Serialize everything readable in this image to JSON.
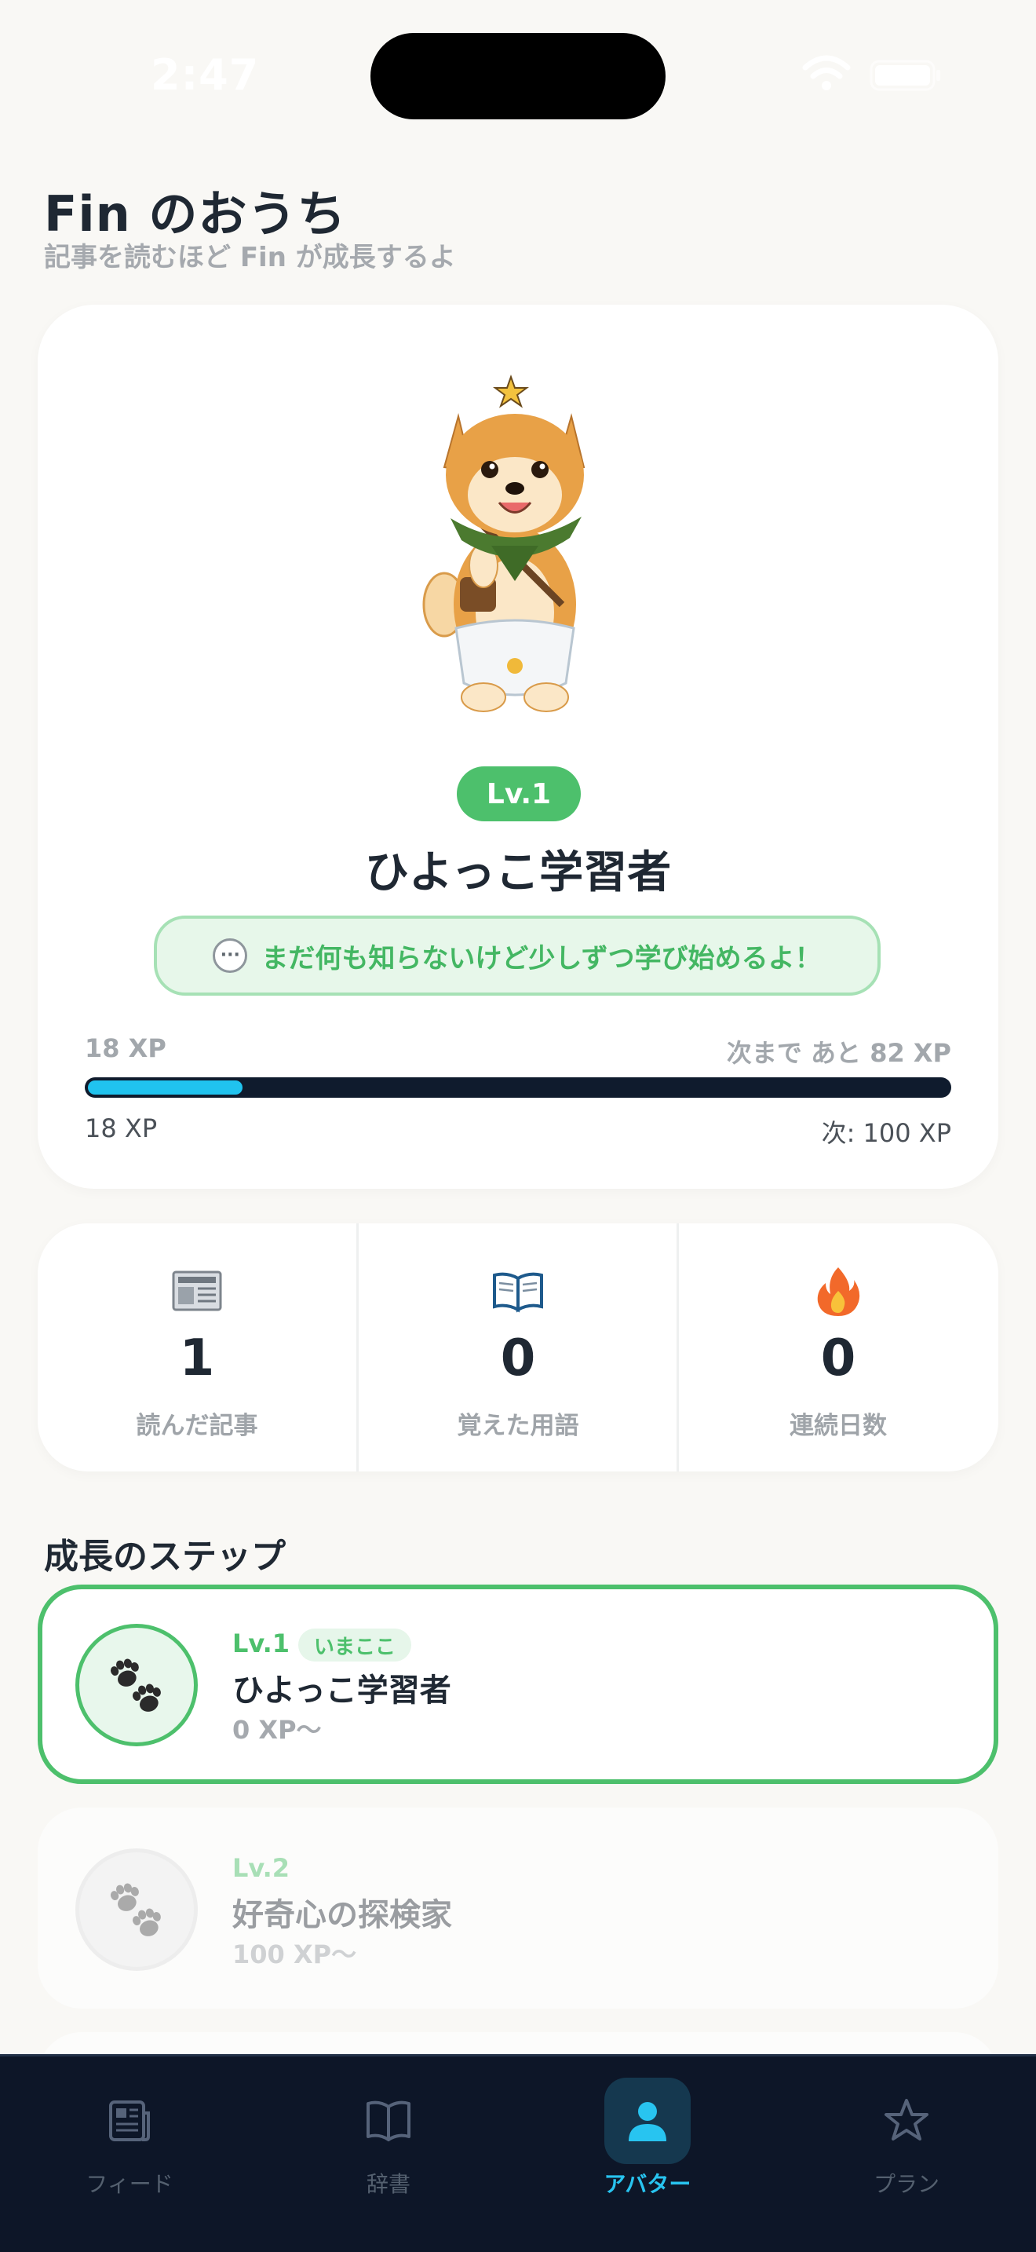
{
  "status_bar": {
    "time": "2:47"
  },
  "header": {
    "title": "Fin のおうち",
    "subtitle": "記事を読むほど Fin が成長するよ"
  },
  "avatar": {
    "level_badge": "Lv.1",
    "level_name": "ひよっこ学習者",
    "speech": "まだ何も知らないけど少しずつ学び始めるよ！",
    "speech_icon": "speech-bubble-icon",
    "xp_label": "18 XP",
    "xp_remaining": "次まで あと 82 XP",
    "xp_current": "18 XP",
    "xp_next": "次: 100 XP",
    "xp_progress": 0.18,
    "colors": {
      "level": "#4dc06c",
      "xp_fill": "#20c3ef",
      "xp_track": "#0f1b2d"
    }
  },
  "stats": [
    {
      "icon": "newspaper-icon",
      "value": "1",
      "label": "読んだ記事"
    },
    {
      "icon": "open-book-icon",
      "value": "0",
      "label": "覚えた用語"
    },
    {
      "icon": "fire-icon",
      "value": "0",
      "label": "連続日数"
    }
  ],
  "steps": {
    "title": "成長のステップ",
    "items": [
      {
        "level": "Lv.1",
        "name": "ひよっこ学習者",
        "xp": "0 XP〜",
        "badge": "いまここ",
        "state": "current"
      },
      {
        "level": "Lv.2",
        "name": "好奇心の探検家",
        "xp": "100 XP〜",
        "state": "locked"
      }
    ]
  },
  "tabbar": {
    "tabs": [
      {
        "label": "フィード",
        "icon": "newspaper-icon",
        "active": false
      },
      {
        "label": "辞書",
        "icon": "book-icon",
        "active": false
      },
      {
        "label": "アバター",
        "icon": "person-icon",
        "active": true
      },
      {
        "label": "プラン",
        "icon": "star-icon",
        "active": false
      }
    ],
    "active_color": "#28c4f0"
  }
}
